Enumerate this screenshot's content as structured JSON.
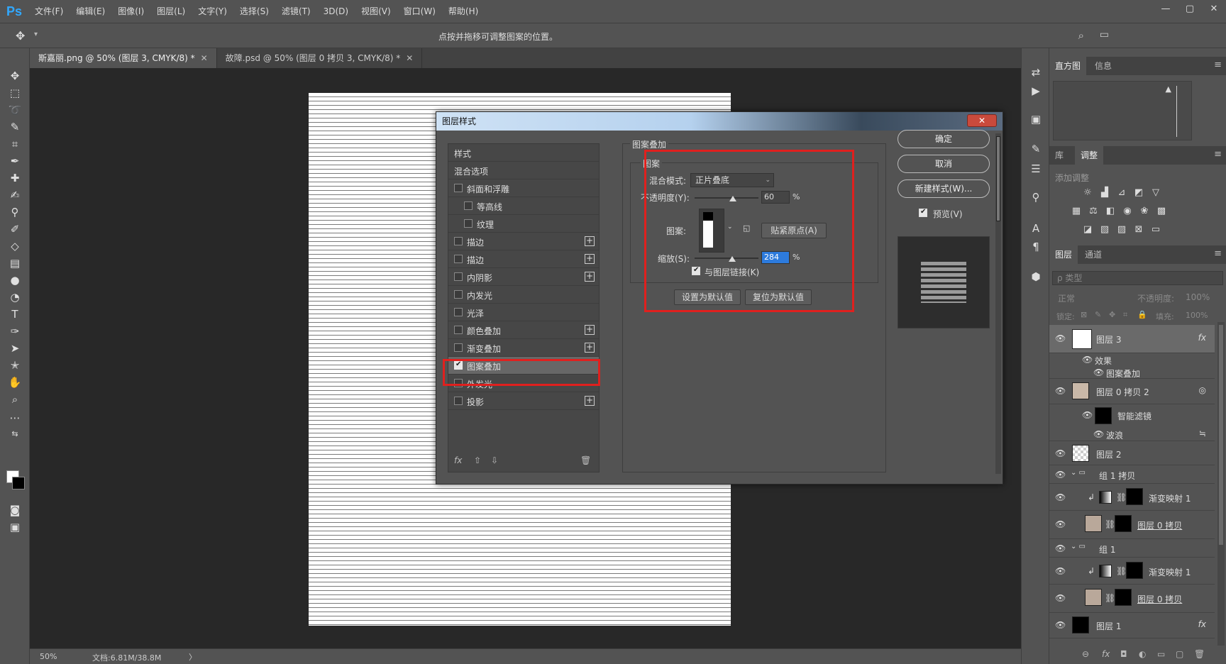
{
  "app": {
    "logo": "Ps",
    "menu": [
      "文件(F)",
      "编辑(E)",
      "图像(I)",
      "图层(L)",
      "文字(Y)",
      "选择(S)",
      "滤镜(T)",
      "3D(D)",
      "视图(V)",
      "窗口(W)",
      "帮助(H)"
    ],
    "window_controls": [
      "—",
      "▢",
      "✕"
    ]
  },
  "options_bar": {
    "hint": "点按并拖移可调整图案的位置。"
  },
  "tabs": [
    {
      "label": "斯嘉丽.png @ 50% (图层 3, CMYK/8) *",
      "close": "✕"
    },
    {
      "label": "故障.psd @ 50% (图层 0 拷贝 3, CMYK/8) *",
      "close": "✕"
    }
  ],
  "status": {
    "zoom": "50%",
    "doc": "文档:6.81M/38.8M",
    "arrow": "〉"
  },
  "dialog": {
    "title": "图层样式",
    "close": "✕",
    "styles_header": "样式",
    "blend_options": "混合选项",
    "style_items": [
      {
        "label": "斜面和浮雕",
        "checked": false,
        "plus": false
      },
      {
        "label": "等高线",
        "checked": false,
        "plus": false
      },
      {
        "label": "纹理",
        "checked": false,
        "plus": false
      },
      {
        "label": "描边",
        "checked": false,
        "plus": true
      },
      {
        "label": "描边",
        "checked": false,
        "plus": true
      },
      {
        "label": "内阴影",
        "checked": false,
        "plus": true
      },
      {
        "label": "内发光",
        "checked": false,
        "plus": false
      },
      {
        "label": "光泽",
        "checked": false,
        "plus": false
      },
      {
        "label": "颜色叠加",
        "checked": false,
        "plus": true
      },
      {
        "label": "渐变叠加",
        "checked": false,
        "plus": true
      },
      {
        "label": "图案叠加",
        "checked": true,
        "plus": false
      },
      {
        "label": "外发光",
        "checked": false,
        "plus": false
      },
      {
        "label": "投影",
        "checked": false,
        "plus": true
      }
    ],
    "plus_glyph": "+",
    "footer": {
      "fx": "fx",
      "up": "⇧",
      "down": "⇩",
      "trash": "🗑"
    },
    "section_title": "图案叠加",
    "group_title": "图案",
    "blend_mode_label": "混合模式:",
    "blend_mode_value": "正片叠底",
    "opacity_label": "不透明度(Y):",
    "opacity_value": "60",
    "opacity_percent": 60,
    "pattern_label": "图案:",
    "snap_origin_btn": "贴紧原点(A)",
    "scale_label": "缩放(S):",
    "scale_value": "284",
    "link_label": "与图层链接(K)",
    "set_default_btn": "设置为默认值",
    "reset_default_btn": "复位为默认值",
    "percent": "%",
    "dropdown": "⌄",
    "ok": "确定",
    "cancel": "取消",
    "new_style": "新建样式(W)...",
    "preview_label": "预览(V)"
  },
  "right_panels": {
    "histogram_tabs": [
      "直方图",
      "信息"
    ],
    "warning_icon": "▲",
    "adj_tabs": [
      "库",
      "调整"
    ],
    "adj_label": "添加调整",
    "menu_glyph": "≡",
    "layers_tabs": [
      "图层",
      "通道"
    ],
    "filter_placeholder": "ρ 类型",
    "blend_mode": "正常",
    "opacity_label": "不透明度:",
    "opacity_value": "100%",
    "lock_label": "锁定:",
    "fill_label": "填充:",
    "fill_value": "100%",
    "layers": [
      {
        "name": "图层 3",
        "fx": "fx"
      },
      {
        "name": "效果"
      },
      {
        "name": "图案叠加"
      },
      {
        "name": "图层 0 拷贝 2"
      },
      {
        "name": "智能滤镜"
      },
      {
        "name": "波浪"
      },
      {
        "name": "图层 2"
      },
      {
        "name": "组 1 拷贝"
      },
      {
        "name": "渐变映射 1"
      },
      {
        "name": "图层 0 拷贝"
      },
      {
        "name": "组 1"
      },
      {
        "name": "渐变映射 1"
      },
      {
        "name": "图层 0 拷贝"
      },
      {
        "name": "图层 1",
        "fx": "fx"
      }
    ],
    "eye": "👁",
    "footer_icons": [
      "⊖",
      "fx",
      "◘",
      "◐",
      "▭",
      "▢",
      "🗑"
    ]
  },
  "colors": {
    "accent_red": "#e0201e",
    "selection_blue": "#2d7bdd",
    "ps_blue": "#31a8ff"
  }
}
